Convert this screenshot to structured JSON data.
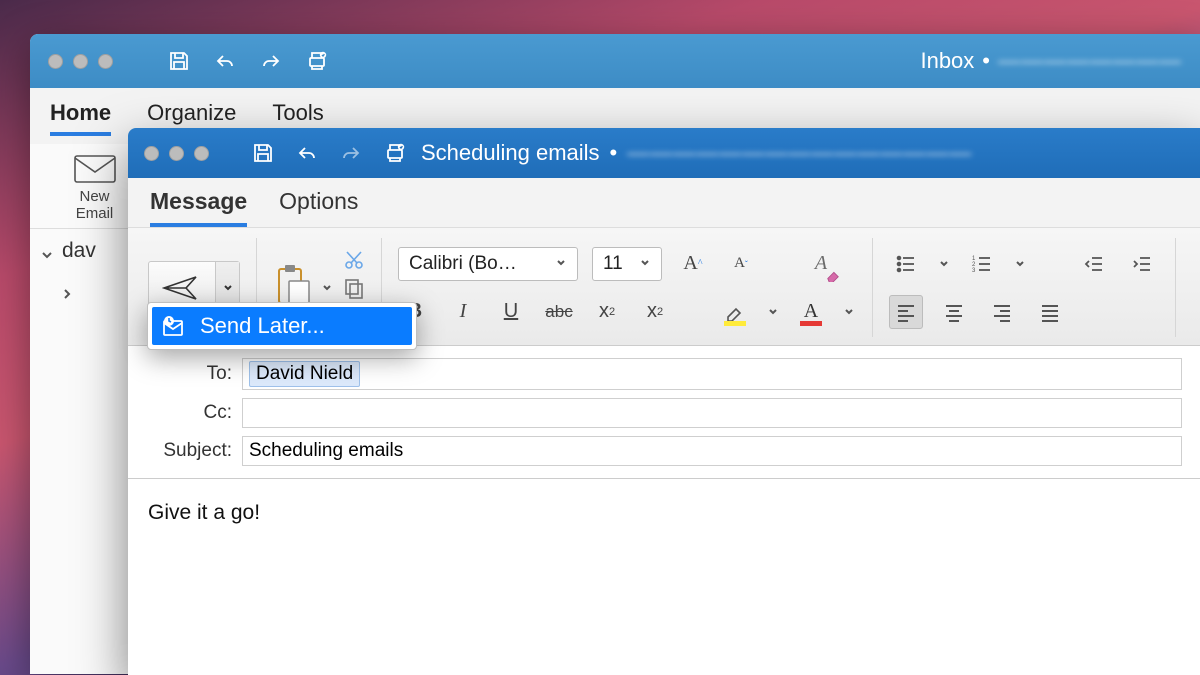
{
  "back_window": {
    "title": "Inbox",
    "tabs": [
      "Home",
      "Organize",
      "Tools"
    ],
    "new_email_label": "New\nEmail",
    "folder_prefix": "dav"
  },
  "front_window": {
    "title": "Scheduling emails",
    "tabs": [
      "Message",
      "Options"
    ],
    "send_dropdown": {
      "send_later": "Send Later..."
    },
    "font": {
      "name": "Calibri (Bo…",
      "size": "11"
    },
    "fields": {
      "to_label": "To:",
      "to_value": "David Nield",
      "cc_label": "Cc:",
      "cc_value": "",
      "subject_label": "Subject:",
      "subject_value": "Scheduling emails"
    },
    "body": "Give it a go!"
  },
  "format": {
    "bold": "B",
    "italic": "I",
    "underline": "U",
    "strike": "abc",
    "subscript_base": "x",
    "subscript_s": "2",
    "superscript_base": "x",
    "superscript_s": "2",
    "grow": "A",
    "shrink": "A",
    "clearfmt": "A"
  }
}
